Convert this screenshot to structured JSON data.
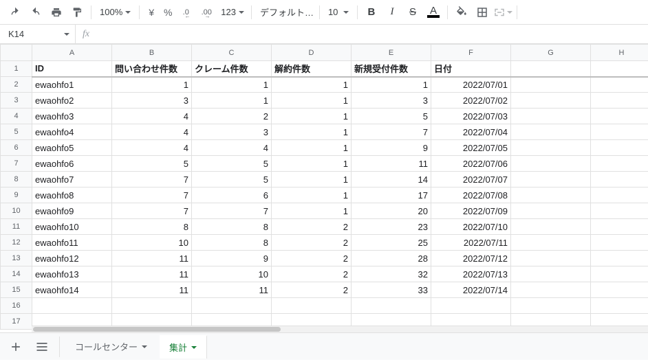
{
  "toolbar": {
    "zoom": "100%",
    "currency": "¥",
    "percent": "%",
    "dec_dec": ".0",
    "dec_inc": ".00",
    "numfmt": "123",
    "font": "デフォルト…",
    "fontsize": "10",
    "bold": "B",
    "italic": "I",
    "strike": "S",
    "textA": "A"
  },
  "namebox": {
    "ref": "K14"
  },
  "fx_label": "fx",
  "columns": [
    "A",
    "B",
    "C",
    "D",
    "E",
    "F",
    "G",
    "H"
  ],
  "headers": {
    "id": "ID",
    "inquiry": "問い合わせ件数",
    "claim": "クレーム件数",
    "cancel": "解約件数",
    "neworder": "新規受付件数",
    "date": "日付"
  },
  "rows": [
    {
      "n": 2,
      "id": "ewaohfo1",
      "inquiry": 1,
      "claim": 1,
      "cancel": 1,
      "neworder": 1,
      "date": "2022/07/01"
    },
    {
      "n": 3,
      "id": "ewaohfo2",
      "inquiry": 3,
      "claim": 1,
      "cancel": 1,
      "neworder": 3,
      "date": "2022/07/02"
    },
    {
      "n": 4,
      "id": "ewaohfo3",
      "inquiry": 4,
      "claim": 2,
      "cancel": 1,
      "neworder": 5,
      "date": "2022/07/03"
    },
    {
      "n": 5,
      "id": "ewaohfo4",
      "inquiry": 4,
      "claim": 3,
      "cancel": 1,
      "neworder": 7,
      "date": "2022/07/04"
    },
    {
      "n": 6,
      "id": "ewaohfo5",
      "inquiry": 4,
      "claim": 4,
      "cancel": 1,
      "neworder": 9,
      "date": "2022/07/05"
    },
    {
      "n": 7,
      "id": "ewaohfo6",
      "inquiry": 5,
      "claim": 5,
      "cancel": 1,
      "neworder": 11,
      "date": "2022/07/06"
    },
    {
      "n": 8,
      "id": "ewaohfo7",
      "inquiry": 7,
      "claim": 5,
      "cancel": 1,
      "neworder": 14,
      "date": "2022/07/07"
    },
    {
      "n": 9,
      "id": "ewaohfo8",
      "inquiry": 7,
      "claim": 6,
      "cancel": 1,
      "neworder": 17,
      "date": "2022/07/08"
    },
    {
      "n": 10,
      "id": "ewaohfo9",
      "inquiry": 7,
      "claim": 7,
      "cancel": 1,
      "neworder": 20,
      "date": "2022/07/09"
    },
    {
      "n": 11,
      "id": "ewaohfo10",
      "inquiry": 8,
      "claim": 8,
      "cancel": 2,
      "neworder": 23,
      "date": "2022/07/10"
    },
    {
      "n": 12,
      "id": "ewaohfo11",
      "inquiry": 10,
      "claim": 8,
      "cancel": 2,
      "neworder": 25,
      "date": "2022/07/11"
    },
    {
      "n": 13,
      "id": "ewaohfo12",
      "inquiry": 11,
      "claim": 9,
      "cancel": 2,
      "neworder": 28,
      "date": "2022/07/12"
    },
    {
      "n": 14,
      "id": "ewaohfo13",
      "inquiry": 11,
      "claim": 10,
      "cancel": 2,
      "neworder": 32,
      "date": "2022/07/13"
    },
    {
      "n": 15,
      "id": "ewaohfo14",
      "inquiry": 11,
      "claim": 11,
      "cancel": 2,
      "neworder": 33,
      "date": "2022/07/14"
    }
  ],
  "tabs": {
    "sheet1": "コールセンター",
    "sheet2": "集計"
  }
}
